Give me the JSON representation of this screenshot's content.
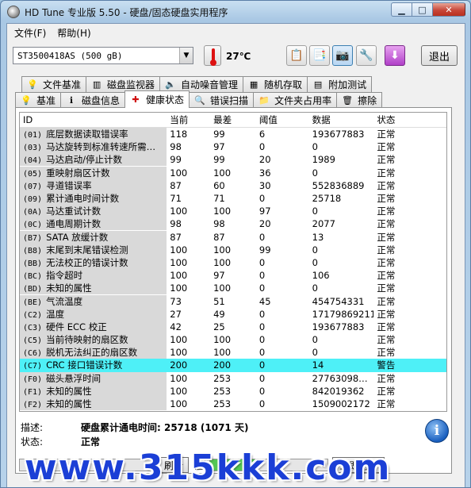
{
  "window": {
    "title": "HD Tune 专业版 5.50 - 硬盘/固态硬盘实用程序"
  },
  "menu": {
    "file": "文件(F)",
    "help": "帮助(H)"
  },
  "toolbar": {
    "drive": "ST3500418AS (500 gB)",
    "temperature": "27℃",
    "exit_label": "退出"
  },
  "tabs_top": [
    {
      "label": "文件基准",
      "icon": "file-benchmark-icon"
    },
    {
      "label": "磁盘监视器",
      "icon": "disk-monitor-icon"
    },
    {
      "label": "自动噪音管理",
      "icon": "speaker-icon"
    },
    {
      "label": "随机存取",
      "icon": "random-access-icon"
    },
    {
      "label": "附加测试",
      "icon": "extra-tests-icon"
    }
  ],
  "tabs_bottom": [
    {
      "label": "基准",
      "icon": "benchmark-icon"
    },
    {
      "label": "磁盘信息",
      "icon": "info-icon"
    },
    {
      "label": "健康状态",
      "icon": "health-cross-icon"
    },
    {
      "label": "错误扫描",
      "icon": "error-scan-icon"
    },
    {
      "label": "文件夹占用率",
      "icon": "folder-icon"
    },
    {
      "label": "擦除",
      "icon": "trash-icon"
    }
  ],
  "grid": {
    "headers": [
      "ID",
      "当前",
      "最差",
      "阈值",
      "数据",
      "状态"
    ],
    "rows": [
      {
        "id": "(01)",
        "name": "底层数据读取错误率",
        "cur": "118",
        "worst": "99",
        "thr": "6",
        "data": "193677883",
        "status": "正常"
      },
      {
        "id": "(03)",
        "name": "马达旋转到标准转速所需…",
        "cur": "98",
        "worst": "97",
        "thr": "0",
        "data": "0",
        "status": "正常"
      },
      {
        "id": "(04)",
        "name": "马达启动/停止计数",
        "cur": "99",
        "worst": "99",
        "thr": "20",
        "data": "1989",
        "status": "正常"
      },
      {
        "id": "(05)",
        "name": "重映射扇区计数",
        "cur": "100",
        "worst": "100",
        "thr": "36",
        "data": "0",
        "status": "正常"
      },
      {
        "id": "(07)",
        "name": "寻道错误率",
        "cur": "87",
        "worst": "60",
        "thr": "30",
        "data": "552836889",
        "status": "正常"
      },
      {
        "id": "(09)",
        "name": "累计通电时间计数",
        "cur": "71",
        "worst": "71",
        "thr": "0",
        "data": "25718",
        "status": "正常"
      },
      {
        "id": "(0A)",
        "name": "马达重试计数",
        "cur": "100",
        "worst": "100",
        "thr": "97",
        "data": "0",
        "status": "正常"
      },
      {
        "id": "(0C)",
        "name": "通电周期计数",
        "cur": "98",
        "worst": "98",
        "thr": "20",
        "data": "2077",
        "status": "正常"
      },
      {
        "id": "(B7)",
        "name": "SATA 放缓计数",
        "cur": "87",
        "worst": "87",
        "thr": "0",
        "data": "13",
        "status": "正常"
      },
      {
        "id": "(B8)",
        "name": "末尾到末尾错误检测",
        "cur": "100",
        "worst": "100",
        "thr": "99",
        "data": "0",
        "status": "正常"
      },
      {
        "id": "(BB)",
        "name": "无法校正的错误计数",
        "cur": "100",
        "worst": "100",
        "thr": "0",
        "data": "0",
        "status": "正常"
      },
      {
        "id": "(BC)",
        "name": "指令超时",
        "cur": "100",
        "worst": "97",
        "thr": "0",
        "data": "106",
        "status": "正常"
      },
      {
        "id": "(BD)",
        "name": "未知的属性",
        "cur": "100",
        "worst": "100",
        "thr": "0",
        "data": "0",
        "status": "正常"
      },
      {
        "id": "(BE)",
        "name": "气流温度",
        "cur": "73",
        "worst": "51",
        "thr": "45",
        "data": "454754331",
        "status": "正常"
      },
      {
        "id": "(C2)",
        "name": "温度",
        "cur": "27",
        "worst": "49",
        "thr": "0",
        "data": "17179869211",
        "status": "正常"
      },
      {
        "id": "(C3)",
        "name": "硬件 ECC 校正",
        "cur": "42",
        "worst": "25",
        "thr": "0",
        "data": "193677883",
        "status": "正常"
      },
      {
        "id": "(C5)",
        "name": "当前待映射的扇区数",
        "cur": "100",
        "worst": "100",
        "thr": "0",
        "data": "0",
        "status": "正常"
      },
      {
        "id": "(C6)",
        "name": "脱机无法纠正的扇区数",
        "cur": "100",
        "worst": "100",
        "thr": "0",
        "data": "0",
        "status": "正常"
      },
      {
        "id": "(C7)",
        "name": "CRC 接口错误计数",
        "cur": "200",
        "worst": "200",
        "thr": "0",
        "data": "14",
        "status": "警告",
        "highlight": true
      },
      {
        "id": "(F0)",
        "name": "磁头悬浮时间",
        "cur": "100",
        "worst": "253",
        "thr": "0",
        "data": "27763098…",
        "status": "正常"
      },
      {
        "id": "(F1)",
        "name": "未知的属性",
        "cur": "100",
        "worst": "253",
        "thr": "0",
        "data": "842019362",
        "status": "正常"
      },
      {
        "id": "(F2)",
        "name": "未知的属性",
        "cur": "100",
        "worst": "253",
        "thr": "0",
        "data": "1509002172",
        "status": "正常"
      }
    ]
  },
  "info": {
    "desc_label": "描述:",
    "desc_value": "硬盘累计通电时间: 25718 (1071 天)",
    "status_label": "状态:",
    "status_value": "正常"
  },
  "bottom": {
    "refresh_label": "刷新",
    "now_label": "立即刷新",
    "progress_fraction": 0.4
  },
  "watermark": "www.315kkk.com"
}
